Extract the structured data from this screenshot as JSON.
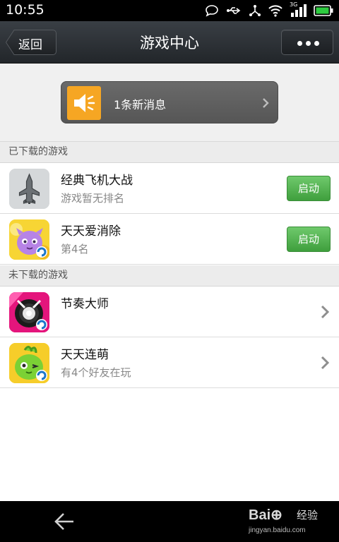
{
  "status_bar": {
    "time": "10:55",
    "network": "3G",
    "icons": [
      "chat-bubble-icon",
      "usb-icon",
      "share-icon",
      "wifi-icon",
      "signal-icon",
      "battery-icon"
    ]
  },
  "header": {
    "back_label": "返回",
    "title": "游戏中心",
    "more_icon": "more-icon"
  },
  "notice": {
    "text": "1条新消息",
    "icon": "speaker-icon",
    "accent_color": "#f6a623"
  },
  "downloaded": {
    "section_title": "已下载的游戏",
    "games": [
      {
        "name": "经典飞机大战",
        "subtitle": "游戏暂无排名",
        "action": "启动"
      },
      {
        "name": "天天爱消除",
        "subtitle": "第4名",
        "action": "启动"
      }
    ]
  },
  "not_downloaded": {
    "section_title": "未下载的游戏",
    "games": [
      {
        "name": "节奏大师",
        "subtitle": ""
      },
      {
        "name": "天天连萌",
        "subtitle": "有4个好友在玩"
      }
    ]
  },
  "watermark": {
    "logo": "Bai⊕",
    "label": "经验",
    "url": "jingyan.baidu.com"
  },
  "colors": {
    "launch_button": "#4caf50",
    "header_bg": "#2b2f33",
    "notice_bg": "#5f5f5f"
  }
}
